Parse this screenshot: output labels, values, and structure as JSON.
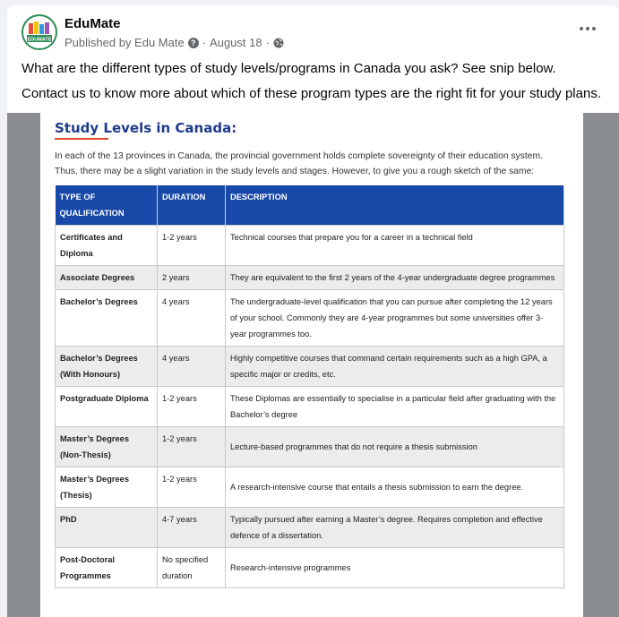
{
  "post": {
    "page_name": "EduMate",
    "published_by": "Published by Edu Mate",
    "separator": "·",
    "date": "August 18",
    "date_separator": "·",
    "text_line1": "What are the different types of study levels/programs in Canada you ask? See snip below.",
    "text_line2": "Contact us to know more about which of these program types are the right fit for your study plans."
  },
  "avatar": {
    "label": "EDUMATE"
  },
  "document": {
    "title": "Study Levels in Canada:",
    "intro": "In each of the 13 provinces in Canada, the provincial government holds complete sovereignty of their education system. Thus, there may be a slight variation in the study levels and stages. However, to give you a rough sketch of the same:",
    "headers": [
      "TYPE OF QUALIFICATION",
      "DURATION",
      "DESCRIPTION"
    ],
    "rows": [
      [
        "Certificates and Diploma",
        "1-2 years",
        "Technical courses that prepare you for a career in a technical field"
      ],
      [
        "Associate Degrees",
        "2 years",
        "They are equivalent to the first 2 years of the 4-year undergraduate degree programmes"
      ],
      [
        "Bachelor’s Degrees",
        "4 years",
        "The undergraduate-level qualification that you can pursue after completing the 12 years of your school. Commonly they are 4-year programmes but some universities offer 3-year programmes too."
      ],
      [
        "Bachelor’s Degrees (With Honours)",
        "4 years",
        "Highly competitive courses that command certain requirements such as a high GPA, a specific major or credits, etc."
      ],
      [
        "Postgraduate Diploma",
        "1-2 years",
        "These Diplomas are essentially to specialise in a particular field after graduating with the Bachelor’s degree"
      ],
      [
        "Master’s Degrees (Non-Thesis)",
        "1-2 years",
        "Lecture-based programmes that do not require a thesis submission"
      ],
      [
        "Master’s Degrees (Thesis)",
        "1-2 years",
        "A research-intensive course that entails a thesis submission to earn the degree."
      ],
      [
        "PhD",
        "4-7 years",
        "Typically pursued after earning a Master’s degree. Requires completion and effective defence of a dissertation."
      ],
      [
        "Post-Doctoral Programmes",
        "No specified duration",
        "Research-intensive programmes"
      ]
    ]
  },
  "icons": {
    "avatar": "edumate-logo-icon",
    "help": "help-icon",
    "privacy": "globe-icon",
    "more": "more-options-icon"
  },
  "colors": {
    "header_blue": "#1848a8",
    "title_blue": "#1f3b8c",
    "accent_red": "#e04a2a",
    "logo_green": "#2e8b57"
  }
}
